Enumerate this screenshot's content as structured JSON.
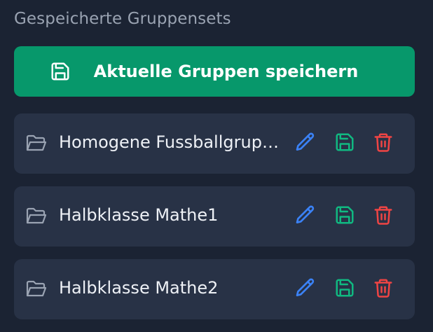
{
  "section": {
    "title": "Gespeicherte Gruppensets"
  },
  "save_button": {
    "label": "Aktuelle Gruppen speichern",
    "icon": "save-icon",
    "color": "#07986b"
  },
  "group_sets": [
    {
      "name": "Homogene Fussballgruppen",
      "icon": "folder-icon"
    },
    {
      "name": "Halbklasse Mathe1",
      "icon": "folder-icon"
    },
    {
      "name": "Halbklasse Mathe2",
      "icon": "folder-icon"
    }
  ],
  "actions": {
    "edit": {
      "icon": "pencil-icon",
      "color": "#3b82f6"
    },
    "save": {
      "icon": "save-icon",
      "color": "#10b981"
    },
    "delete": {
      "icon": "trash-icon",
      "color": "#ef4444"
    }
  },
  "colors": {
    "background": "#1b2333",
    "card": "#283246",
    "title_text": "#9aa3b2",
    "item_text": "#eef1f6",
    "folder_icon": "#9aa3b2"
  }
}
